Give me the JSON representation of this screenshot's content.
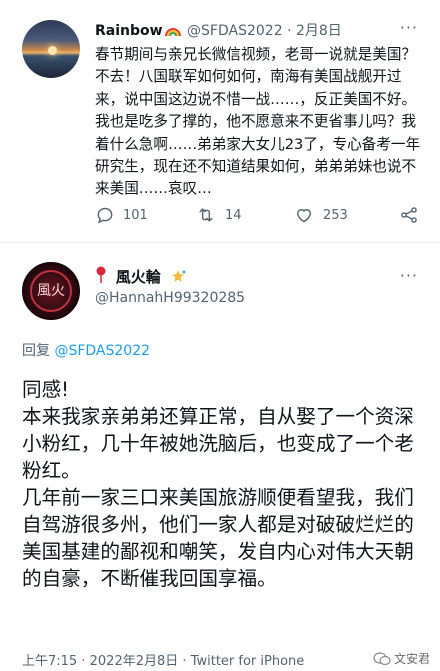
{
  "tweet1": {
    "display_name": "Rainbow",
    "handle": "@SFDAS2022",
    "separator": "·",
    "date": "2月8日",
    "text": "春节期间与亲兄长微信视频，老哥一说就是美国？不去！八国联军如何如何，南海有美国战舰开过来，说中国这边说不惜一战……，反正美国不好。我也是吃多了撑的，他不愿意来不更省事儿吗？我着什么急啊……弟弟家大女儿23了，专心备考一年研究生，现在还不知道结果如何，弟弟弟妹也说不来美国……哀叹…",
    "replies": "101",
    "retweets": "14",
    "likes": "253",
    "more": "···"
  },
  "tweet2": {
    "display_name": "風火輪",
    "handle": "@HannahH99320285",
    "more": "···",
    "reply_prefix": "回复",
    "reply_to": "@SFDAS2022",
    "paragraphs": [
      "同感!",
      "本来我家亲弟弟还算正常，自从娶了一个资深小粉红，几十年被她洗脑后，也变成了一个老粉红。",
      "几年前一家三口来美国旅游顺便看望我，我们自驾游很多州，他们一家人都是对破破烂烂的美国基建的鄙视和嘲笑，发自内心对伟大天朝的自豪，不断催我回国享福。"
    ],
    "time": "上午7:15",
    "date": "2022年2月8日",
    "client": "Twitter for iPhone"
  },
  "watermark": "文安君",
  "colors": {
    "text": "#0f1419",
    "secondary": "#536471",
    "link": "#1d9bf0",
    "divider": "#eff3f4"
  }
}
